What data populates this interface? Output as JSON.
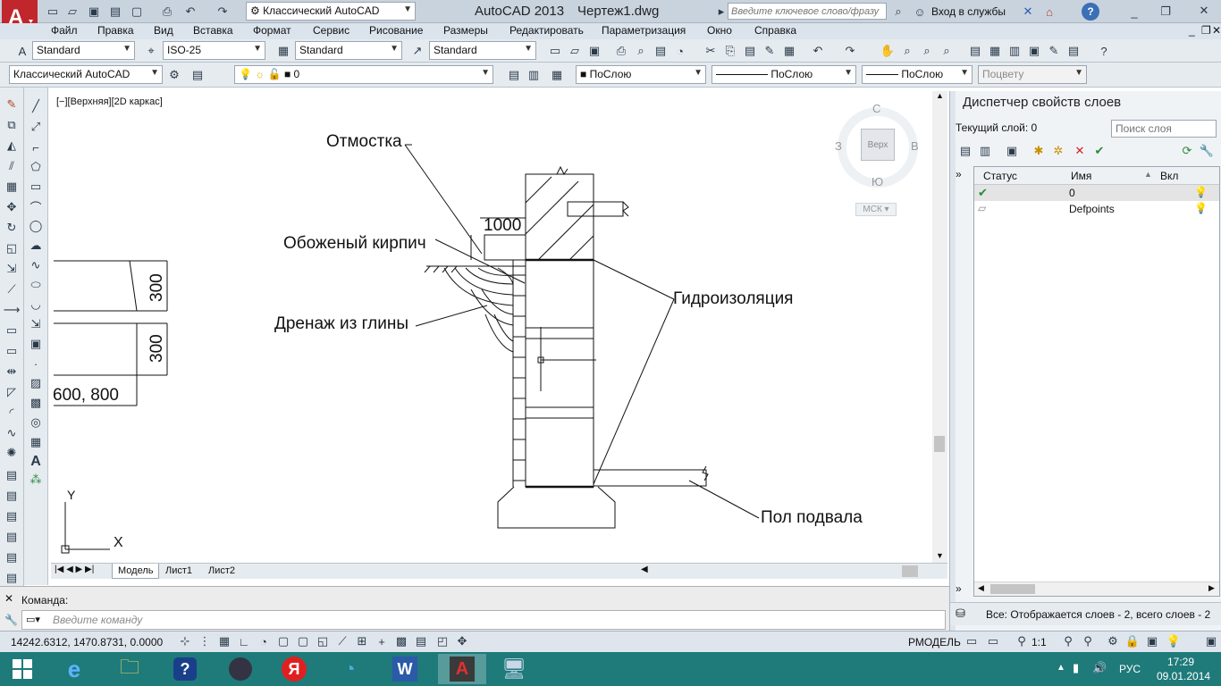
{
  "title_bar": {
    "app_title": "AutoCAD 2013",
    "document_title": "Чертеж1.dwg",
    "workspace": "Классический AutoCAD",
    "search_placeholder": "Введите ключевое слово/фразу",
    "signin_label": "Вход в службы",
    "help_label": "?"
  },
  "menu": [
    "Файл",
    "Правка",
    "Вид",
    "Вставка",
    "Формат",
    "Сервис",
    "Рисование",
    "Размеры",
    "Редактировать",
    "Параметризация",
    "Окно",
    "Справка"
  ],
  "styles_toolbar": {
    "text_style": "Standard",
    "dim_style": "ISO-25",
    "table_style": "Standard",
    "mleader_style": "Standard"
  },
  "props_toolbar": {
    "workspace": "Классический AutoCAD",
    "layer": "0",
    "color": "ПоСлою",
    "linetype": "ПоСлою",
    "lineweight": "ПоСлою",
    "plotstyle": "Поцвету"
  },
  "viewport_label": "[−][Верхняя][2D каркас]",
  "viewcube": {
    "top": "Верх",
    "north": "С",
    "south": "Ю",
    "west": "З",
    "east": "В",
    "ucs": "МСК"
  },
  "drawing_labels": {
    "otmostka": "Отмостка",
    "kirpich": "Обоженый кирпич",
    "drenazh": "Дренаж из глины",
    "gidro": "Гидроизоляция",
    "pol": "Пол подвала",
    "dim1000": "1000",
    "dim300a": "300",
    "dim300b": "300",
    "dim600": "600, 800"
  },
  "ucs_icon": {
    "y": "Y",
    "x": "X"
  },
  "tabs": [
    "Модель",
    "Лист1",
    "Лист2"
  ],
  "command": {
    "label": "Команда:",
    "placeholder": "Введите команду"
  },
  "status": {
    "coords": "14242.6312, 1470.8731, 0.0000",
    "model": "РМОДЕЛЬ",
    "scale": "1:1"
  },
  "layer_panel": {
    "title": "Диспетчер свойств слоев",
    "current_layer": "Текущий слой: 0",
    "search_placeholder": "Поиск слоя",
    "columns": [
      "Статус",
      "Имя",
      "Вкл"
    ],
    "rows": [
      {
        "name": "0",
        "current": true
      },
      {
        "name": "Defpoints",
        "current": false
      }
    ],
    "footer": "Все: Отображается слоев - 2, всего слоев - 2"
  },
  "tray": {
    "lang": "РУС",
    "time": "17:29",
    "date": "09.01.2014"
  },
  "colors": {
    "accent_title": "#c9d3de",
    "toolbar": "#e6ebf0",
    "taskbar": "#1f7a7a",
    "autocad_red": "#c0262c"
  }
}
